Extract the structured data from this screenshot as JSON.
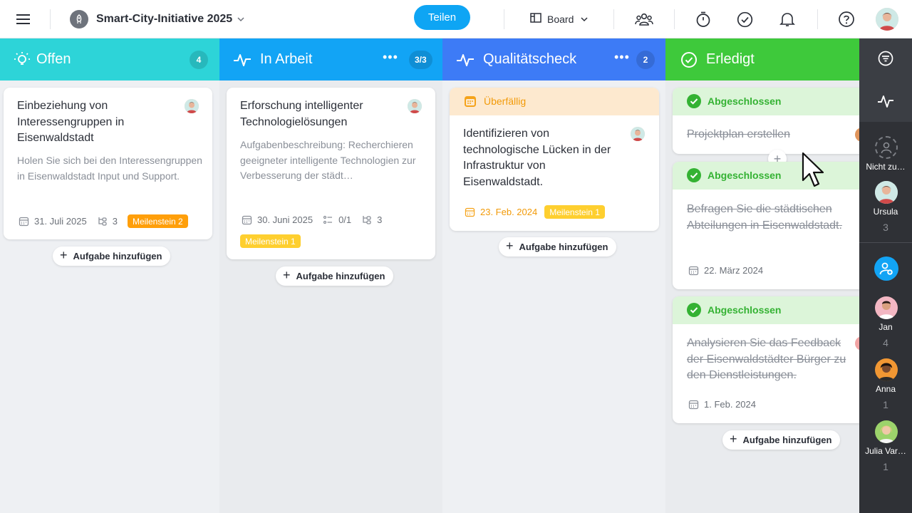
{
  "header": {
    "project_title": "Smart-City-Initiative 2025",
    "share_label": "Teilen",
    "view_label": "Board"
  },
  "columns": [
    {
      "title": "Offen",
      "count": "4",
      "color": "#2dd4d8",
      "cards": [
        {
          "title": "Einbeziehung von Interessengruppen in Eisenwaldstadt",
          "description": "Holen Sie sich bei den Interessengruppen in Eisenwaldstadt Input und Support.",
          "date": "31. Juli 2025",
          "subtasks": "3",
          "milestone": "Meilenstein 2"
        }
      ],
      "add_label": "Aufgabe hinzufügen"
    },
    {
      "title": "In Arbeit",
      "count": "3/3",
      "color": "#12a4f5",
      "cards": [
        {
          "title": "Erforschung intelligenter Technologielösungen",
          "description": "Aufgabenbeschreibung: Recherchieren geeigneter intelligente Technologien zur Verbesserung der städt…",
          "date": "30. Juni 2025",
          "checklist": "0/1",
          "subtasks": "3",
          "milestone": "Meilenstein 1"
        }
      ],
      "add_label": "Aufgabe hinzufügen"
    },
    {
      "title": "Qualitätscheck",
      "count": "2",
      "color": "#3d7bf6",
      "cards": [
        {
          "status": "Überfällig",
          "title": "Identifizieren von technologische Lücken in der Infrastruktur von Eisenwaldstadt.",
          "date": "23. Feb. 2024",
          "milestone": "Meilenstein 1"
        }
      ],
      "add_label": "Aufgabe hinzufügen"
    },
    {
      "title": "Erledigt",
      "color": "#3ec93b",
      "cards": [
        {
          "status": "Abgeschlossen",
          "title": "Projektplan erstellen"
        },
        {
          "status": "Abgeschlossen",
          "title": "Befragen Sie die städtischen Abteilungen in Eisenwaldstadt.",
          "date": "22. März 2024"
        },
        {
          "status": "Abgeschlossen",
          "title": "Analysieren Sie das Feedback der Eisenwaldstädter Bürger zu den Dienstleistungen.",
          "date": "1. Feb. 2024"
        }
      ],
      "add_label": "Aufgabe hinzufügen"
    }
  ],
  "sidebar": {
    "unassigned_label": "Nicht zu…",
    "members": [
      {
        "name": "Ursula",
        "count": "3"
      },
      {
        "name": "Jan",
        "count": "4"
      },
      {
        "name": "Anna",
        "count": "1"
      },
      {
        "name": "Julia Var…",
        "count": "1"
      }
    ]
  }
}
